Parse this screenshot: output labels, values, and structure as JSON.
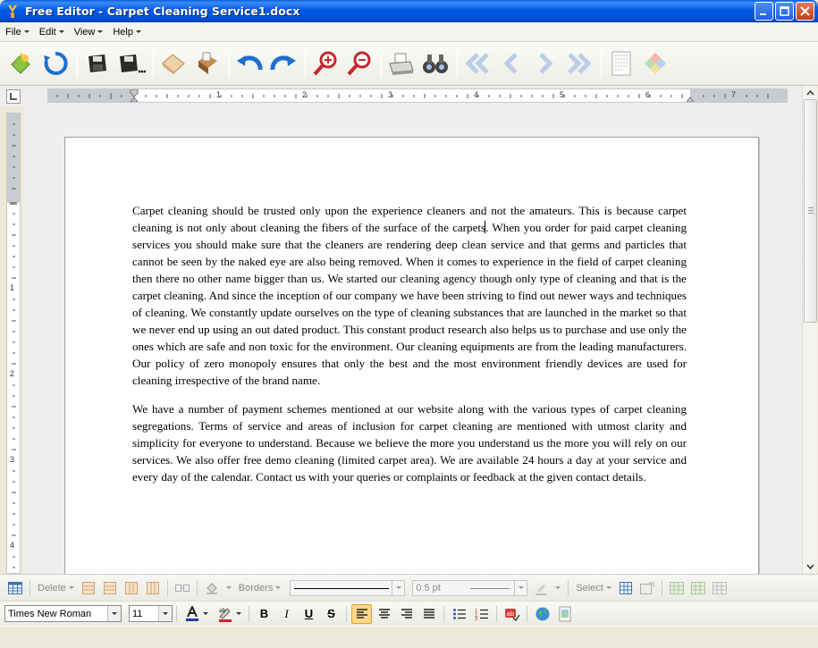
{
  "window": {
    "title": "Free Editor - Carpet Cleaning Service1.docx"
  },
  "menu": {
    "items": [
      {
        "label": "File"
      },
      {
        "label": "Edit"
      },
      {
        "label": "View"
      },
      {
        "label": "Help"
      }
    ]
  },
  "toolbar": {
    "icons": [
      "new-document-icon",
      "refresh-icon",
      "save-icon",
      "save-as-icon",
      "erase-icon",
      "paste-icon",
      "undo-icon",
      "redo-icon",
      "zoom-in-icon",
      "zoom-out-icon",
      "print-icon",
      "find-icon",
      "first-page-icon",
      "previous-page-icon",
      "next-page-icon",
      "last-page-icon",
      "page-layout-icon",
      "fit-icon"
    ]
  },
  "ruler": {
    "h_numbers": [
      "1",
      "2",
      "3",
      "4",
      "5",
      "6",
      "7"
    ],
    "v_numbers": [
      "1",
      "2",
      "3",
      "4"
    ]
  },
  "document": {
    "paragraphs": [
      {
        "before_cursor": "Carpet cleaning should be trusted only upon the experience cleaners and not the amateurs. This is because carpet cleaning is not only about cleaning the fibers of the surface of the carpets",
        "after_cursor": ". When you order for paid carpet cleaning services you should make sure that the cleaners are rendering deep clean service and that germs and particles that cannot be seen by the naked eye are also being removed. When it comes to experience in the field of carpet cleaning then there no other name bigger than us. We started our cleaning agency though only type of cleaning and that is the carpet cleaning. And since the inception of our company we have been striving to find out newer ways and techniques of cleaning. We constantly update ourselves on the type of cleaning substances that are launched in the market so that we never end up using an out dated product. This constant product research also helps us to purchase and use only the ones which are safe and non toxic for the environment. Our cleaning equipments are from the leading manufacturers. Our policy of zero monopoly ensures that only the best and the most environment friendly devices are used for cleaning irrespective of the brand name."
      },
      {
        "text": "We have a number of payment schemes mentioned at our website along with the various types of carpet cleaning segregations. Terms of service and areas of inclusion for carpet cleaning are mentioned with utmost clarity and simplicity for everyone to understand. Because we believe the more you understand us the more you will rely on our services. We also offer free demo cleaning (limited carpet area). We are available 24 hours a day at your service and every day of the calendar. Contact us with your queries or complaints or feedback at the given contact details."
      }
    ]
  },
  "table_toolbar": {
    "delete_label": "Delete",
    "borders_label": "Borders",
    "line_width": "0.5 pt",
    "select_label": "Select"
  },
  "format_toolbar": {
    "font_name": "Times New Roman",
    "font_size": "11",
    "bold": "B",
    "italic": "I",
    "underline": "U",
    "strike": "S",
    "alignment": "left"
  },
  "colors": {
    "title_bar": "#0058e6",
    "active_button": "#ffd88a",
    "font_color": "#1f3fa0",
    "highlight_color": "#d02020"
  }
}
